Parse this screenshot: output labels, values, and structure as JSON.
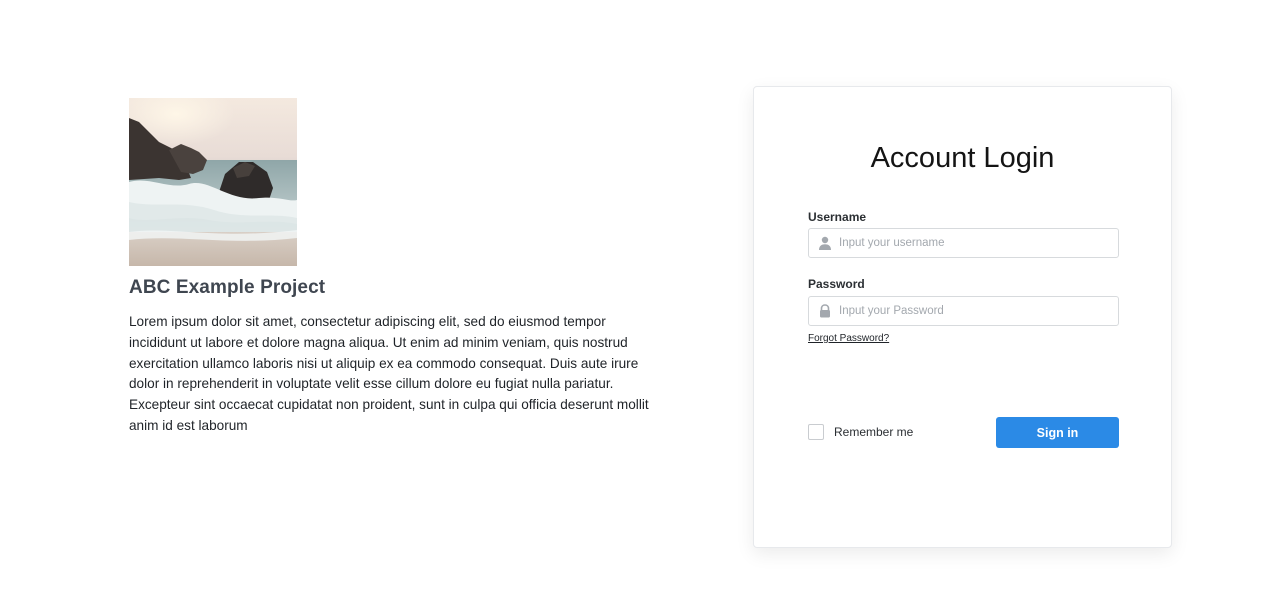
{
  "project": {
    "image_alt": "Rocky beach with ocean waves",
    "title": "ABC Example Project",
    "description": "Lorem ipsum dolor sit amet, consectetur adipiscing elit, sed do eiusmod tempor incididunt ut labore et dolore magna aliqua. Ut enim ad minim veniam, quis nostrud exercitation ullamco laboris nisi ut aliquip ex ea commodo consequat. Duis aute irure dolor in reprehenderit in voluptate velit esse cillum dolore eu fugiat nulla pariatur. Excepteur sint occaecat cupidatat non proident, sunt in culpa qui officia deserunt mollit anim id est laborum"
  },
  "login": {
    "title": "Account Login",
    "username": {
      "label": "Username",
      "placeholder": "Input your username",
      "value": "",
      "icon": "user-icon"
    },
    "password": {
      "label": "Password",
      "placeholder": "Input your Password",
      "value": "",
      "icon": "lock-icon"
    },
    "forgot_label": "Forgot Password?",
    "remember_label": "Remember me",
    "remember_checked": false,
    "signin_label": "Sign in"
  },
  "colors": {
    "primary": "#2b8ae6",
    "title_text": "#3f4650",
    "border": "#d7dadd",
    "placeholder": "#a3a8ae"
  }
}
